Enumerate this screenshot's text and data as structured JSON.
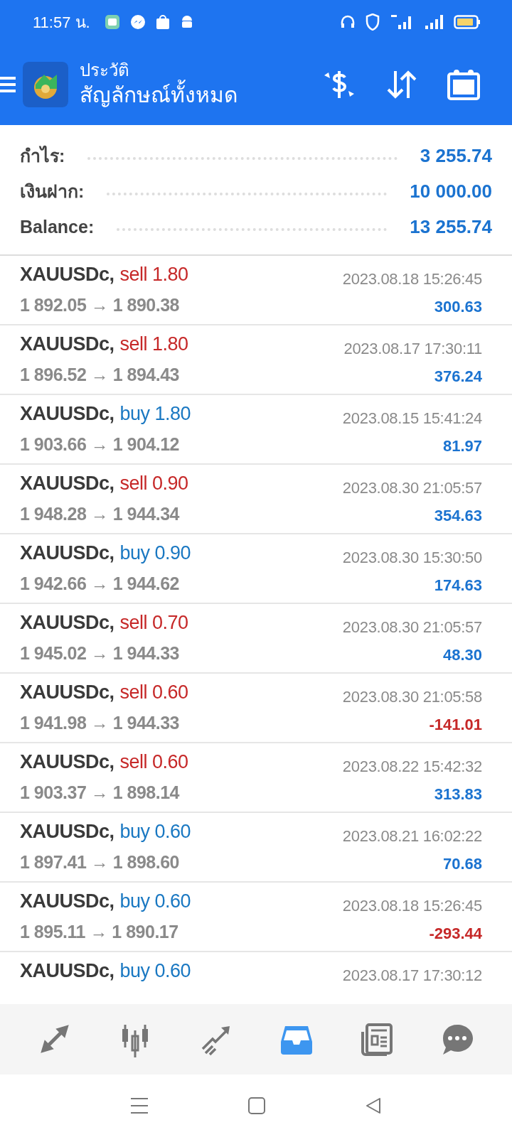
{
  "status_bar": {
    "time": "11:57 น."
  },
  "header": {
    "title": "ประวัติ",
    "subtitle": "สัญลักษณ์ทั้งหมด"
  },
  "summary": [
    {
      "label": "กำไร:",
      "value": "3 255.74"
    },
    {
      "label": "เงินฝาก:",
      "value": "10 000.00"
    },
    {
      "label": "Balance:",
      "value": "13 255.74"
    }
  ],
  "trades": [
    {
      "symbol": "XAUUSDc,",
      "kind": "sell",
      "action": "sell 1.80",
      "prices": "1 892.05 → 1 890.38",
      "time": "2023.08.18 15:26:45",
      "profit": "300.63",
      "loss": false
    },
    {
      "symbol": "XAUUSDc,",
      "kind": "sell",
      "action": "sell 1.80",
      "prices": "1 896.52 → 1 894.43",
      "time": "2023.08.17 17:30:11",
      "profit": "376.24",
      "loss": false
    },
    {
      "symbol": "XAUUSDc,",
      "kind": "buy",
      "action": "buy 1.80",
      "prices": "1 903.66 → 1 904.12",
      "time": "2023.08.15 15:41:24",
      "profit": "81.97",
      "loss": false
    },
    {
      "symbol": "XAUUSDc,",
      "kind": "sell",
      "action": "sell 0.90",
      "prices": "1 948.28 → 1 944.34",
      "time": "2023.08.30 21:05:57",
      "profit": "354.63",
      "loss": false
    },
    {
      "symbol": "XAUUSDc,",
      "kind": "buy",
      "action": "buy 0.90",
      "prices": "1 942.66 → 1 944.62",
      "time": "2023.08.30 15:30:50",
      "profit": "174.63",
      "loss": false
    },
    {
      "symbol": "XAUUSDc,",
      "kind": "sell",
      "action": "sell 0.70",
      "prices": "1 945.02 → 1 944.33",
      "time": "2023.08.30 21:05:57",
      "profit": "48.30",
      "loss": false
    },
    {
      "symbol": "XAUUSDc,",
      "kind": "sell",
      "action": "sell 0.60",
      "prices": "1 941.98 → 1 944.33",
      "time": "2023.08.30 21:05:58",
      "profit": "-141.01",
      "loss": true
    },
    {
      "symbol": "XAUUSDc,",
      "kind": "sell",
      "action": "sell 0.60",
      "prices": "1 903.37 → 1 898.14",
      "time": "2023.08.22 15:42:32",
      "profit": "313.83",
      "loss": false
    },
    {
      "symbol": "XAUUSDc,",
      "kind": "buy",
      "action": "buy 0.60",
      "prices": "1 897.41 → 1 898.60",
      "time": "2023.08.21 16:02:22",
      "profit": "70.68",
      "loss": false
    },
    {
      "symbol": "XAUUSDc,",
      "kind": "buy",
      "action": "buy 0.60",
      "prices": "1 895.11 → 1 890.17",
      "time": "2023.08.18 15:26:45",
      "profit": "-293.44",
      "loss": true
    },
    {
      "symbol": "XAUUSDc,",
      "kind": "buy",
      "action": "buy 0.60",
      "time": "2023.08.17 17:30:12"
    }
  ],
  "bottom_nav": [
    {
      "kind": "quotes",
      "selected": false
    },
    {
      "kind": "chart",
      "selected": false
    },
    {
      "kind": "trade",
      "selected": false
    },
    {
      "kind": "history",
      "selected": true
    },
    {
      "kind": "news",
      "selected": false
    },
    {
      "kind": "chat",
      "selected": false
    }
  ]
}
